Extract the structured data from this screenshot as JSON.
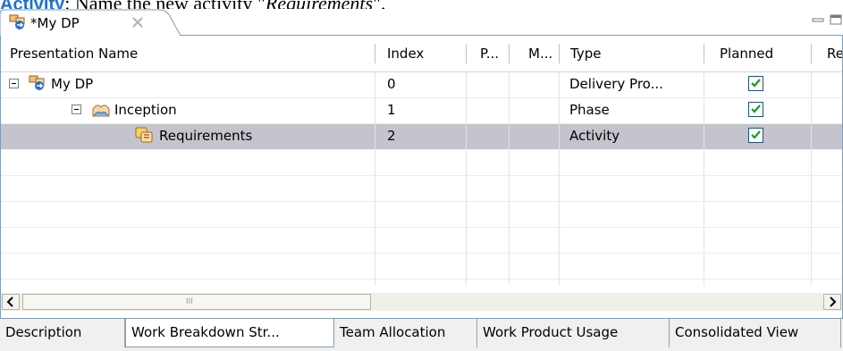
{
  "caption": {
    "lead": "Activity",
    "text": ": Name the new activity \"",
    "italic": "Requirements",
    "tail": "\"."
  },
  "editor_tab": {
    "title": "*My DP"
  },
  "columns": [
    "Presentation Name",
    "Index",
    "P...",
    "M...",
    "Type",
    "Planned",
    "Re"
  ],
  "rows": [
    {
      "name": "My DP",
      "index": "0",
      "type": "Delivery Pro...",
      "planned": true,
      "icon": "delivery-process-icon"
    },
    {
      "name": "Inception",
      "index": "1",
      "type": "Phase",
      "planned": true,
      "icon": "phase-icon"
    },
    {
      "name": "Requirements",
      "index": "2",
      "type": "Activity",
      "planned": true,
      "icon": "activity-icon"
    }
  ],
  "scroll_grip": "III",
  "bottom_tabs": [
    "Description",
    "Work Breakdown Str...",
    "Team Allocation",
    "Work Product Usage",
    "Consolidated View"
  ],
  "colors": {
    "selection": "#c4c4cc",
    "caption_lead": "#1f6fd0",
    "border": "#7f9db9",
    "check": "#1c9a1c"
  }
}
